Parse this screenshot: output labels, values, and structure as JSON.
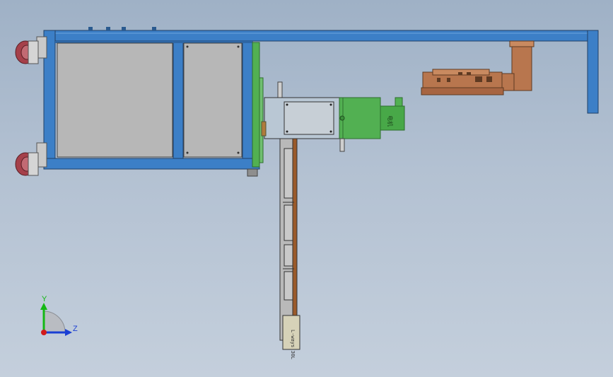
{
  "viewport": {
    "background_top": "#9fb1c6",
    "background_bottom": "#c4cfdc"
  },
  "colors": {
    "frame_blue": "#3c7fc7",
    "frame_dark": "#1f3f66",
    "panel_gray": "#b7b7b7",
    "green": "#52b052",
    "copper": "#b8764e",
    "caster_red": "#a5404a",
    "rail_gray": "#b9b9b9",
    "axis_y": "#14b814",
    "axis_z": "#1a3fd4",
    "axis_x": "#d11a1a"
  },
  "motor_label": "电机",
  "cartridge_label": "L-ways 30L",
  "triad": {
    "y_label": "Y",
    "z_label": "Z"
  }
}
